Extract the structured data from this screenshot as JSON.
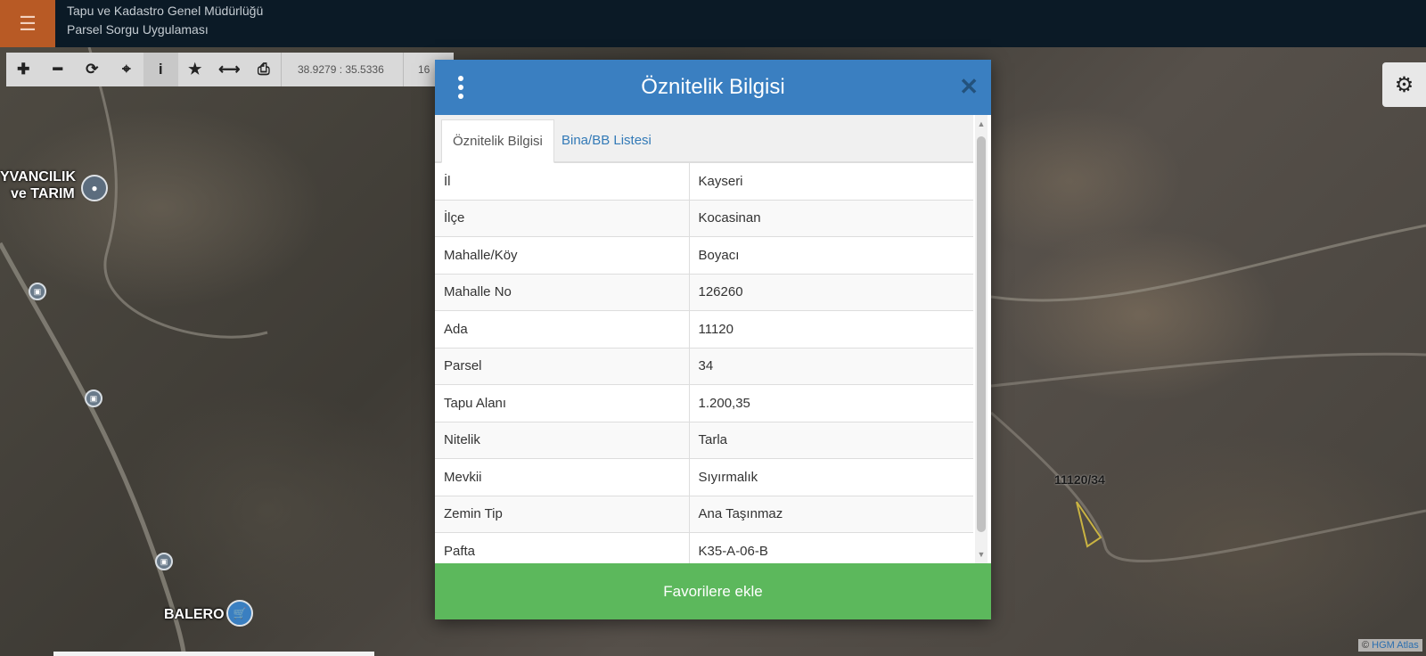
{
  "header": {
    "title_line1": "Tapu ve Kadastro Genel Müdürlüğü",
    "title_line2": "Parsel Sorgu Uygulaması",
    "menu_icon": "hamburger-icon",
    "brand_color": "#b85a25"
  },
  "toolbar": {
    "tools": [
      "zoom-in-icon",
      "zoom-out-icon",
      "refresh-icon",
      "locate-icon",
      "info-icon",
      "star-icon",
      "measure-icon",
      "print-icon"
    ],
    "coordinates": "38.9279 : 35.5336",
    "scale_partial": "16"
  },
  "map": {
    "labels": [
      "YVANCILIK",
      "ve TARIM",
      "BALERO"
    ],
    "parcel_label": "11120/34",
    "attribution_prefix": "© ",
    "attribution_link": "HGM Atlas"
  },
  "modal": {
    "title": "Öznitelik Bilgisi",
    "tabs": [
      "Öznitelik Bilgisi",
      "Bina/BB Listesi"
    ],
    "rows": [
      {
        "key": "İl",
        "value": "Kayseri"
      },
      {
        "key": "İlçe",
        "value": "Kocasinan"
      },
      {
        "key": "Mahalle/Köy",
        "value": "Boyacı"
      },
      {
        "key": "Mahalle No",
        "value": "126260"
      },
      {
        "key": "Ada",
        "value": "11120"
      },
      {
        "key": "Parsel",
        "value": "34"
      },
      {
        "key": "Tapu Alanı",
        "value": "1.200,35"
      },
      {
        "key": "Nitelik",
        "value": "Tarla"
      },
      {
        "key": "Mevkii",
        "value": "Sıyırmalık"
      },
      {
        "key": "Zemin Tip",
        "value": "Ana Taşınmaz"
      },
      {
        "key": "Pafta",
        "value": "K35-A-06-B"
      }
    ],
    "favorite_button": "Favorilere ekle",
    "header_color": "#3a7fc1",
    "button_color": "#5cb85c"
  }
}
